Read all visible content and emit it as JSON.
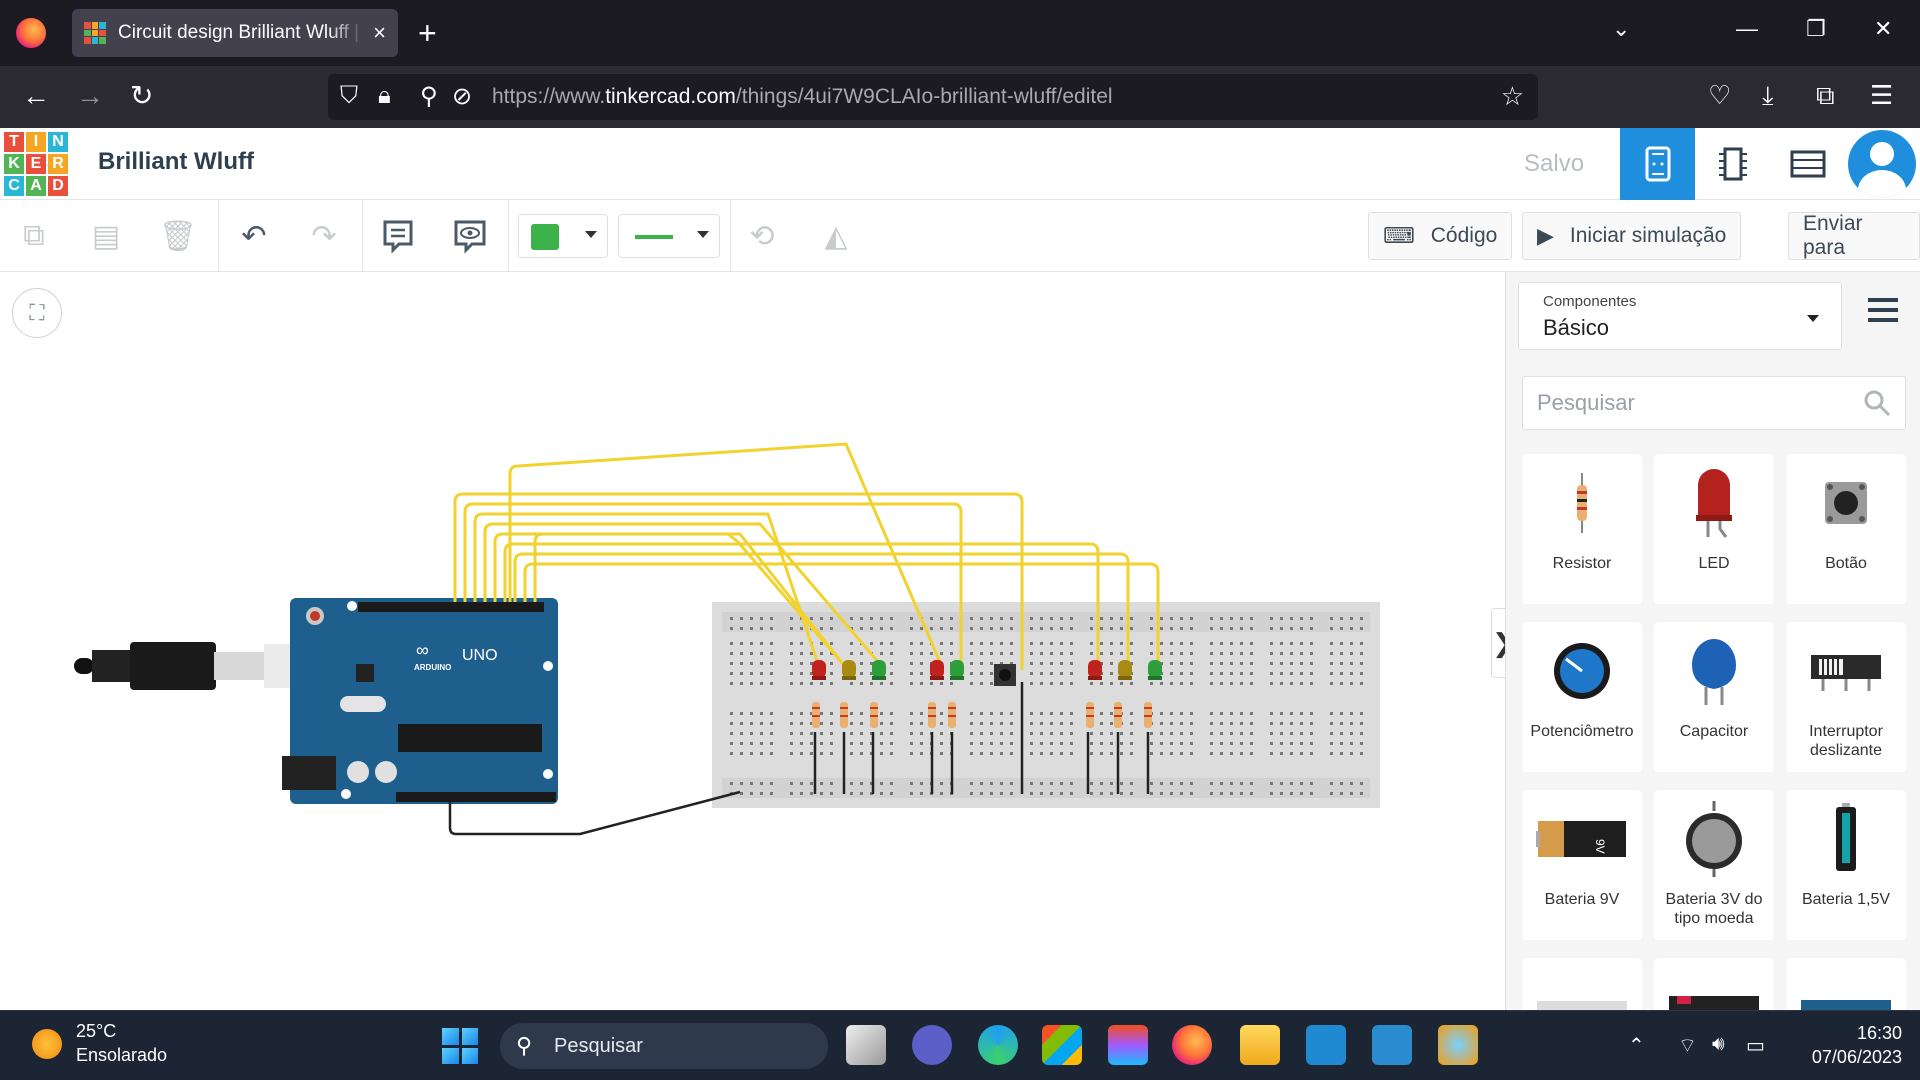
{
  "browser": {
    "tab_title": "Circuit design Brilliant Wluff | Tinkercad",
    "new_tab": "+",
    "close_tab": "×",
    "url_prefix": "https://www.",
    "url_domain": "tinkercad.com",
    "url_path": "/things/4ui7W9CLAIo-brilliant-wluff/editel"
  },
  "app": {
    "logo_letters": [
      "T",
      "I",
      "N",
      "K",
      "E",
      "R",
      "C",
      "A",
      "D"
    ],
    "design_title": "Brilliant Wluff",
    "save_status": "Salvo"
  },
  "toolbar": {
    "code_label": "Código",
    "simulate_label": "Iniciar simulação",
    "send_label": "Enviar para",
    "wire_color": "#3cb34a"
  },
  "panel": {
    "category_label": "Componentes",
    "category_value": "Básico",
    "search_placeholder": "Pesquisar",
    "components": [
      {
        "name": "Resistor"
      },
      {
        "name": "LED"
      },
      {
        "name": "Botão"
      },
      {
        "name": "Potenciômetro"
      },
      {
        "name": "Capacitor"
      },
      {
        "name": "Interruptor deslizante"
      },
      {
        "name": "Bateria 9V"
      },
      {
        "name": "Bateria 3V do tipo moeda"
      },
      {
        "name": "Bateria 1,5V"
      }
    ]
  },
  "circuit": {
    "arduino_label": "UNO",
    "arduino_brand": "ARDUINO",
    "battery_label": "9V"
  },
  "taskbar": {
    "temperature": "25°C",
    "weather": "Ensolarado",
    "search_placeholder": "Pesquisar",
    "time": "16:30",
    "date": "07/06/2023"
  },
  "colors": {
    "accent": "#1f8fdd",
    "wire": "#f2d22e",
    "led_red": "#c0231e",
    "led_yellow": "#a88b12",
    "led_green": "#2e9e3a"
  }
}
